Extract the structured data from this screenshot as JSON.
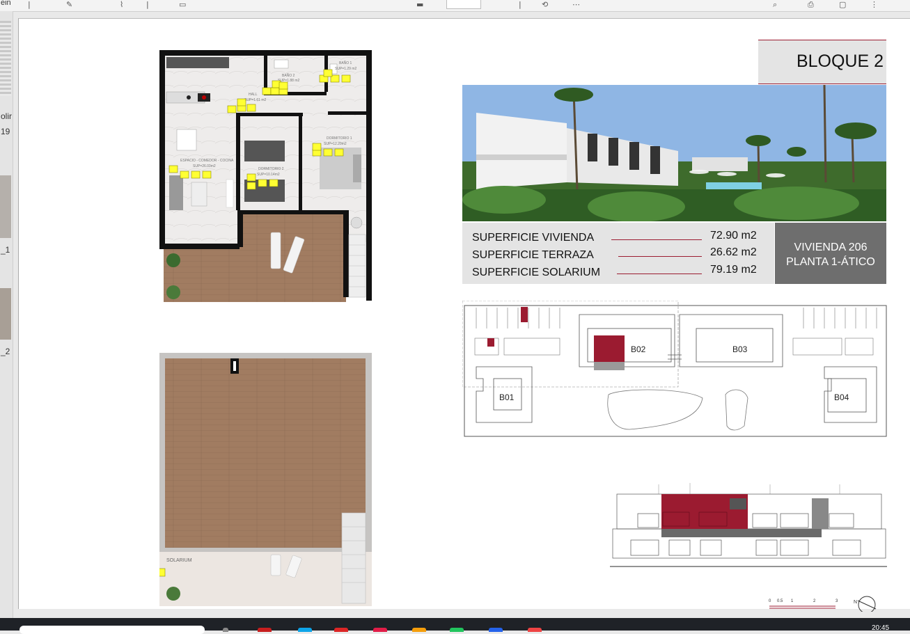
{
  "window": {
    "left_labels": [
      "ein",
      "olir",
      "19",
      "_1",
      "_2"
    ]
  },
  "taskbar": {
    "clock": "20:45",
    "icon_colors": [
      "#3b82f6",
      "#e11d48",
      "#0ea5e9",
      "#dc2626",
      "#16a34a",
      "#f59e0b",
      "#2563eb",
      "#ef4444"
    ]
  },
  "sheet": {
    "block_title": "BLOQUE 2",
    "areas": [
      {
        "label": "SUPERFICIE VIVIENDA",
        "value": "72.90 m2"
      },
      {
        "label": "SUPERFICIE TERRAZA",
        "value": "26.62 m2"
      },
      {
        "label": "SUPERFICIE SOLARIUM",
        "value": "79.19 m2"
      }
    ],
    "unit": {
      "line1": "VIVIENDA 206",
      "line2": "PLANTA 1-ÁTICO"
    },
    "site_blocks": [
      "B01",
      "B02",
      "B03",
      "B04"
    ],
    "scale_ticks": [
      "0",
      "0.5",
      "1",
      "2",
      "3"
    ],
    "north_label": "N",
    "rooms": [
      {
        "name": "BAÑO 2",
        "area": "SUP=1.88 m2"
      },
      {
        "name": "BAÑO 1",
        "area": "SUP=1.29 m2"
      },
      {
        "name": "HALL",
        "area": "SUP=1.61 m2"
      },
      {
        "name": "DORMITORIO 1",
        "area": "SUP=12.20m2"
      },
      {
        "name": "ESPACIO - COMEDOR - COCINA",
        "area": "SUP=26.03m2"
      },
      {
        "name": "DORMITORIO 2",
        "area": "SUP=10.14m2"
      }
    ],
    "solarium_label": "SOLARIUM",
    "accent_color": "#9b1b30"
  }
}
